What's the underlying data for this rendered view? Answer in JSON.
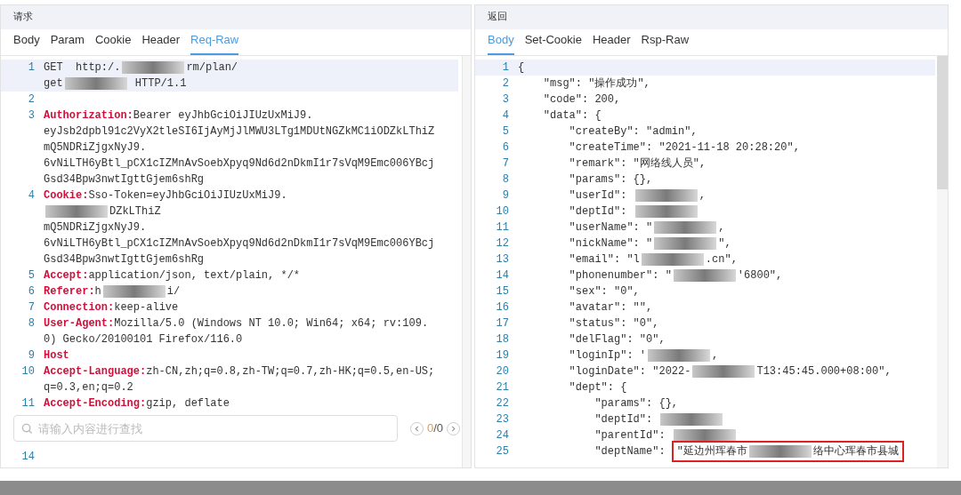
{
  "request": {
    "title": "请求",
    "tabs": [
      {
        "label": "Body",
        "selected": false
      },
      {
        "label": "Param",
        "selected": false
      },
      {
        "label": "Cookie",
        "selected": false
      },
      {
        "label": "Header",
        "selected": false
      },
      {
        "label": "Req-Raw",
        "selected": true
      }
    ],
    "lines": [
      {
        "number": "1",
        "selected": true,
        "rows": [
          [
            {
              "kind": "text",
              "text": "GET  http:/."
            },
            {
              "kind": "redacted"
            },
            {
              "kind": "text",
              "text": "rm/plan/"
            }
          ],
          [
            {
              "kind": "text",
              "text": "get"
            },
            {
              "kind": "redacted"
            },
            {
              "kind": "text",
              "text": " HTTP/1.1"
            }
          ]
        ]
      },
      {
        "number": "2",
        "selected": false,
        "rows": [
          []
        ]
      },
      {
        "number": "3",
        "selected": false,
        "rows": [
          [
            {
              "kind": "key",
              "text": "Authorization:"
            },
            {
              "kind": "text",
              "text": "Bearer eyJhbGciOiJIUzUxMiJ9."
            }
          ],
          [
            {
              "kind": "text",
              "text": "eyJsb2dpbl91c2VyX2tleSI6IjAyMjJlMWU3LTg1MDUtNGZkMC1iODZkLThiZ"
            }
          ],
          [
            {
              "kind": "text",
              "text": "mQ5NDRiZjgxNyJ9."
            }
          ],
          [
            {
              "kind": "text",
              "text": "6vNiLTH6yBtl_pCX1cIZMnAvSoebXpyq9Nd6d2nDkmI1r7sVqM9Emc006YBcj"
            }
          ],
          [
            {
              "kind": "text",
              "text": "Gsd34Bpw3nwtIgttGjem6shRg"
            }
          ]
        ]
      },
      {
        "number": "4",
        "selected": false,
        "rows": [
          [
            {
              "kind": "key",
              "text": "Cookie:"
            },
            {
              "kind": "text",
              "text": "Sso-Token=eyJhbGciOiJIUzUxMiJ9."
            }
          ],
          [
            {
              "kind": "redacted"
            },
            {
              "kind": "text",
              "text": "DZkLThiZ"
            }
          ],
          [
            {
              "kind": "text",
              "text": "mQ5NDRiZjgxNyJ9."
            }
          ],
          [
            {
              "kind": "text",
              "text": "6vNiLTH6yBtl_pCX1cIZMnAvSoebXpyq9Nd6d2nDkmI1r7sVqM9Emc006YBcj"
            }
          ],
          [
            {
              "kind": "text",
              "text": "Gsd34Bpw3nwtIgttGjem6shRg"
            }
          ]
        ]
      },
      {
        "number": "5",
        "selected": false,
        "rows": [
          [
            {
              "kind": "key",
              "text": "Accept:"
            },
            {
              "kind": "text",
              "text": "application/json, text/plain, */*"
            }
          ]
        ]
      },
      {
        "number": "6",
        "selected": false,
        "rows": [
          [
            {
              "kind": "key",
              "text": "Referer:"
            },
            {
              "kind": "text",
              "text": "h"
            },
            {
              "kind": "redacted"
            },
            {
              "kind": "text",
              "text": "i/"
            }
          ]
        ]
      },
      {
        "number": "7",
        "selected": false,
        "rows": [
          [
            {
              "kind": "key",
              "text": "Connection:"
            },
            {
              "kind": "text",
              "text": "keep-alive"
            }
          ]
        ]
      },
      {
        "number": "8",
        "selected": false,
        "rows": [
          [
            {
              "kind": "key",
              "text": "User-Agent:"
            },
            {
              "kind": "text",
              "text": "Mozilla/5.0 (Windows NT 10.0; Win64; x64; rv:109."
            }
          ],
          [
            {
              "kind": "text",
              "text": "0) Gecko/20100101 Firefox/116.0"
            }
          ]
        ]
      },
      {
        "number": "9",
        "selected": false,
        "rows": [
          [
            {
              "kind": "key",
              "text": "Host"
            }
          ]
        ]
      },
      {
        "number": "10",
        "selected": false,
        "rows": [
          [
            {
              "kind": "key",
              "text": "Accept-Language:"
            },
            {
              "kind": "text",
              "text": "zh-CN,zh;q=0.8,zh-TW;q=0.7,zh-HK;q=0.5,en-US;"
            }
          ],
          [
            {
              "kind": "text",
              "text": "q=0.3,en;q=0.2"
            }
          ]
        ]
      },
      {
        "number": "11",
        "selected": false,
        "rows": [
          [
            {
              "kind": "key",
              "text": "Accept-Encoding:"
            },
            {
              "kind": "text",
              "text": "gzip, deflate"
            }
          ]
        ]
      }
    ],
    "after_search": [
      {
        "number": "14",
        "selected": false,
        "rows": [
          []
        ]
      }
    ],
    "search": {
      "placeholder": "请输入内容进行查找",
      "index": "0",
      "rest": "/0"
    }
  },
  "response": {
    "title": "返回",
    "tabs": [
      {
        "label": "Body",
        "selected": true
      },
      {
        "label": "Set-Cookie",
        "selected": false
      },
      {
        "label": "Header",
        "selected": false
      },
      {
        "label": "Rsp-Raw",
        "selected": false
      }
    ],
    "lines": [
      {
        "number": "1",
        "selected": true,
        "rows": [
          [
            {
              "kind": "text",
              "text": "{"
            }
          ]
        ]
      },
      {
        "number": "2",
        "selected": false,
        "rows": [
          [
            {
              "kind": "text",
              "text": "    \"msg\": \"操作成功\","
            }
          ]
        ]
      },
      {
        "number": "3",
        "selected": false,
        "rows": [
          [
            {
              "kind": "text",
              "text": "    \"code\": 200,"
            }
          ]
        ]
      },
      {
        "number": "4",
        "selected": false,
        "rows": [
          [
            {
              "kind": "text",
              "text": "    \"data\": {"
            }
          ]
        ]
      },
      {
        "number": "5",
        "selected": false,
        "rows": [
          [
            {
              "kind": "text",
              "text": "        \"createBy\": \"admin\","
            }
          ]
        ]
      },
      {
        "number": "6",
        "selected": false,
        "rows": [
          [
            {
              "kind": "text",
              "text": "        \"createTime\": \"2021-11-18 20:28:20\","
            }
          ]
        ]
      },
      {
        "number": "7",
        "selected": false,
        "rows": [
          [
            {
              "kind": "text",
              "text": "        \"remark\": \"网络线人员\","
            }
          ]
        ]
      },
      {
        "number": "8",
        "selected": false,
        "rows": [
          [
            {
              "kind": "text",
              "text": "        \"params\": {},"
            }
          ]
        ]
      },
      {
        "number": "9",
        "selected": false,
        "rows": [
          [
            {
              "kind": "text",
              "text": "        \"userId\": "
            },
            {
              "kind": "redacted"
            },
            {
              "kind": "text",
              "text": ","
            }
          ]
        ]
      },
      {
        "number": "10",
        "selected": false,
        "rows": [
          [
            {
              "kind": "text",
              "text": "        \"deptId\": "
            },
            {
              "kind": "redacted"
            }
          ]
        ]
      },
      {
        "number": "11",
        "selected": false,
        "rows": [
          [
            {
              "kind": "text",
              "text": "        \"userName\": \""
            },
            {
              "kind": "redacted"
            },
            {
              "kind": "text",
              "text": ","
            }
          ]
        ]
      },
      {
        "number": "12",
        "selected": false,
        "rows": [
          [
            {
              "kind": "text",
              "text": "        \"nickName\": \""
            },
            {
              "kind": "redacted"
            },
            {
              "kind": "text",
              "text": "\","
            }
          ]
        ]
      },
      {
        "number": "13",
        "selected": false,
        "rows": [
          [
            {
              "kind": "text",
              "text": "        \"email\": \"l"
            },
            {
              "kind": "redacted"
            },
            {
              "kind": "text",
              "text": ".cn\","
            }
          ]
        ]
      },
      {
        "number": "14",
        "selected": false,
        "rows": [
          [
            {
              "kind": "text",
              "text": "        \"phonenumber\": \""
            },
            {
              "kind": "redacted"
            },
            {
              "kind": "text",
              "text": "'6800\","
            }
          ]
        ]
      },
      {
        "number": "15",
        "selected": false,
        "rows": [
          [
            {
              "kind": "text",
              "text": "        \"sex\": \"0\","
            }
          ]
        ]
      },
      {
        "number": "16",
        "selected": false,
        "rows": [
          [
            {
              "kind": "text",
              "text": "        \"avatar\": \"\","
            }
          ]
        ]
      },
      {
        "number": "17",
        "selected": false,
        "rows": [
          [
            {
              "kind": "text",
              "text": "        \"status\": \"0\","
            }
          ]
        ]
      },
      {
        "number": "18",
        "selected": false,
        "rows": [
          [
            {
              "kind": "text",
              "text": "        \"delFlag\": \"0\","
            }
          ]
        ]
      },
      {
        "number": "19",
        "selected": false,
        "rows": [
          [
            {
              "kind": "text",
              "text": "        \"loginIp\": '"
            },
            {
              "kind": "redacted"
            },
            {
              "kind": "text",
              "text": ","
            }
          ]
        ]
      },
      {
        "number": "20",
        "selected": false,
        "rows": [
          [
            {
              "kind": "text",
              "text": "        \"loginDate\": \"2022-"
            },
            {
              "kind": "redacted"
            },
            {
              "kind": "text",
              "text": "T13:45:45.000+08:00\","
            }
          ]
        ]
      },
      {
        "number": "21",
        "selected": false,
        "rows": [
          [
            {
              "kind": "text",
              "text": "        \"dept\": {"
            }
          ]
        ]
      },
      {
        "number": "22",
        "selected": false,
        "rows": [
          [
            {
              "kind": "text",
              "text": "            \"params\": {},"
            }
          ]
        ]
      },
      {
        "number": "23",
        "selected": false,
        "rows": [
          [
            {
              "kind": "text",
              "text": "            \"deptId\": "
            },
            {
              "kind": "redacted"
            }
          ]
        ]
      },
      {
        "number": "24",
        "selected": false,
        "rows": [
          [
            {
              "kind": "text",
              "text": "            \"parentId\": "
            },
            {
              "kind": "redacted"
            }
          ]
        ]
      },
      {
        "number": "25",
        "selected": false,
        "rows": [
          [
            {
              "kind": "text",
              "text": "            \"deptName\": "
            },
            {
              "kind": "boxed",
              "parts": [
                {
                  "kind": "text",
                  "text": "\"延边州珲春市"
                },
                {
                  "kind": "redacted"
                },
                {
                  "kind": "text",
                  "text": "络中心珲春市县城"
                }
              ]
            }
          ]
        ]
      }
    ]
  }
}
